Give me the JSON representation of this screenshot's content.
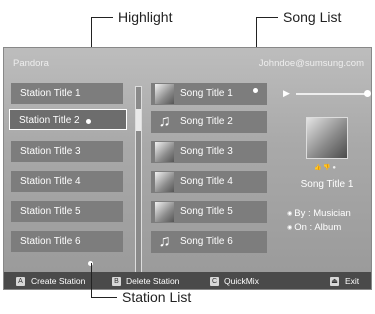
{
  "callouts": {
    "highlight": "Highlight",
    "song_list": "Song List",
    "station_list": "Station List"
  },
  "header": {
    "app_title": "Pandora",
    "account": "Johndoe@sumsung.com"
  },
  "stations": [
    {
      "label": "Station Title 1"
    },
    {
      "label": "Station Title 2",
      "highlighted": true
    },
    {
      "label": "Station Title 3"
    },
    {
      "label": "Station Title 4"
    },
    {
      "label": "Station Title 5"
    },
    {
      "label": "Station Title 6"
    }
  ],
  "songs": [
    {
      "label": "Song Title 1",
      "thumb": "album-art-icon"
    },
    {
      "label": "Song Title 2",
      "thumb": "music-note-icon"
    },
    {
      "label": "Song Title 3",
      "thumb": "album-art-icon"
    },
    {
      "label": "Song Title 4",
      "thumb": "album-art-icon"
    },
    {
      "label": "Song Title 5",
      "thumb": "album-art-icon"
    },
    {
      "label": "Song Title 6",
      "thumb": "music-note-icon"
    }
  ],
  "now_playing": {
    "title": "Song Title 1",
    "by": "By : Musician",
    "on": "On : Album",
    "progress_fraction": 0.95
  },
  "footer": {
    "a_key": "A",
    "a_label": "Create Station",
    "b_key": "B",
    "b_label": "Delete Station",
    "c_key": "C",
    "c_label": "QuickMix",
    "exit_label": "Exit"
  }
}
